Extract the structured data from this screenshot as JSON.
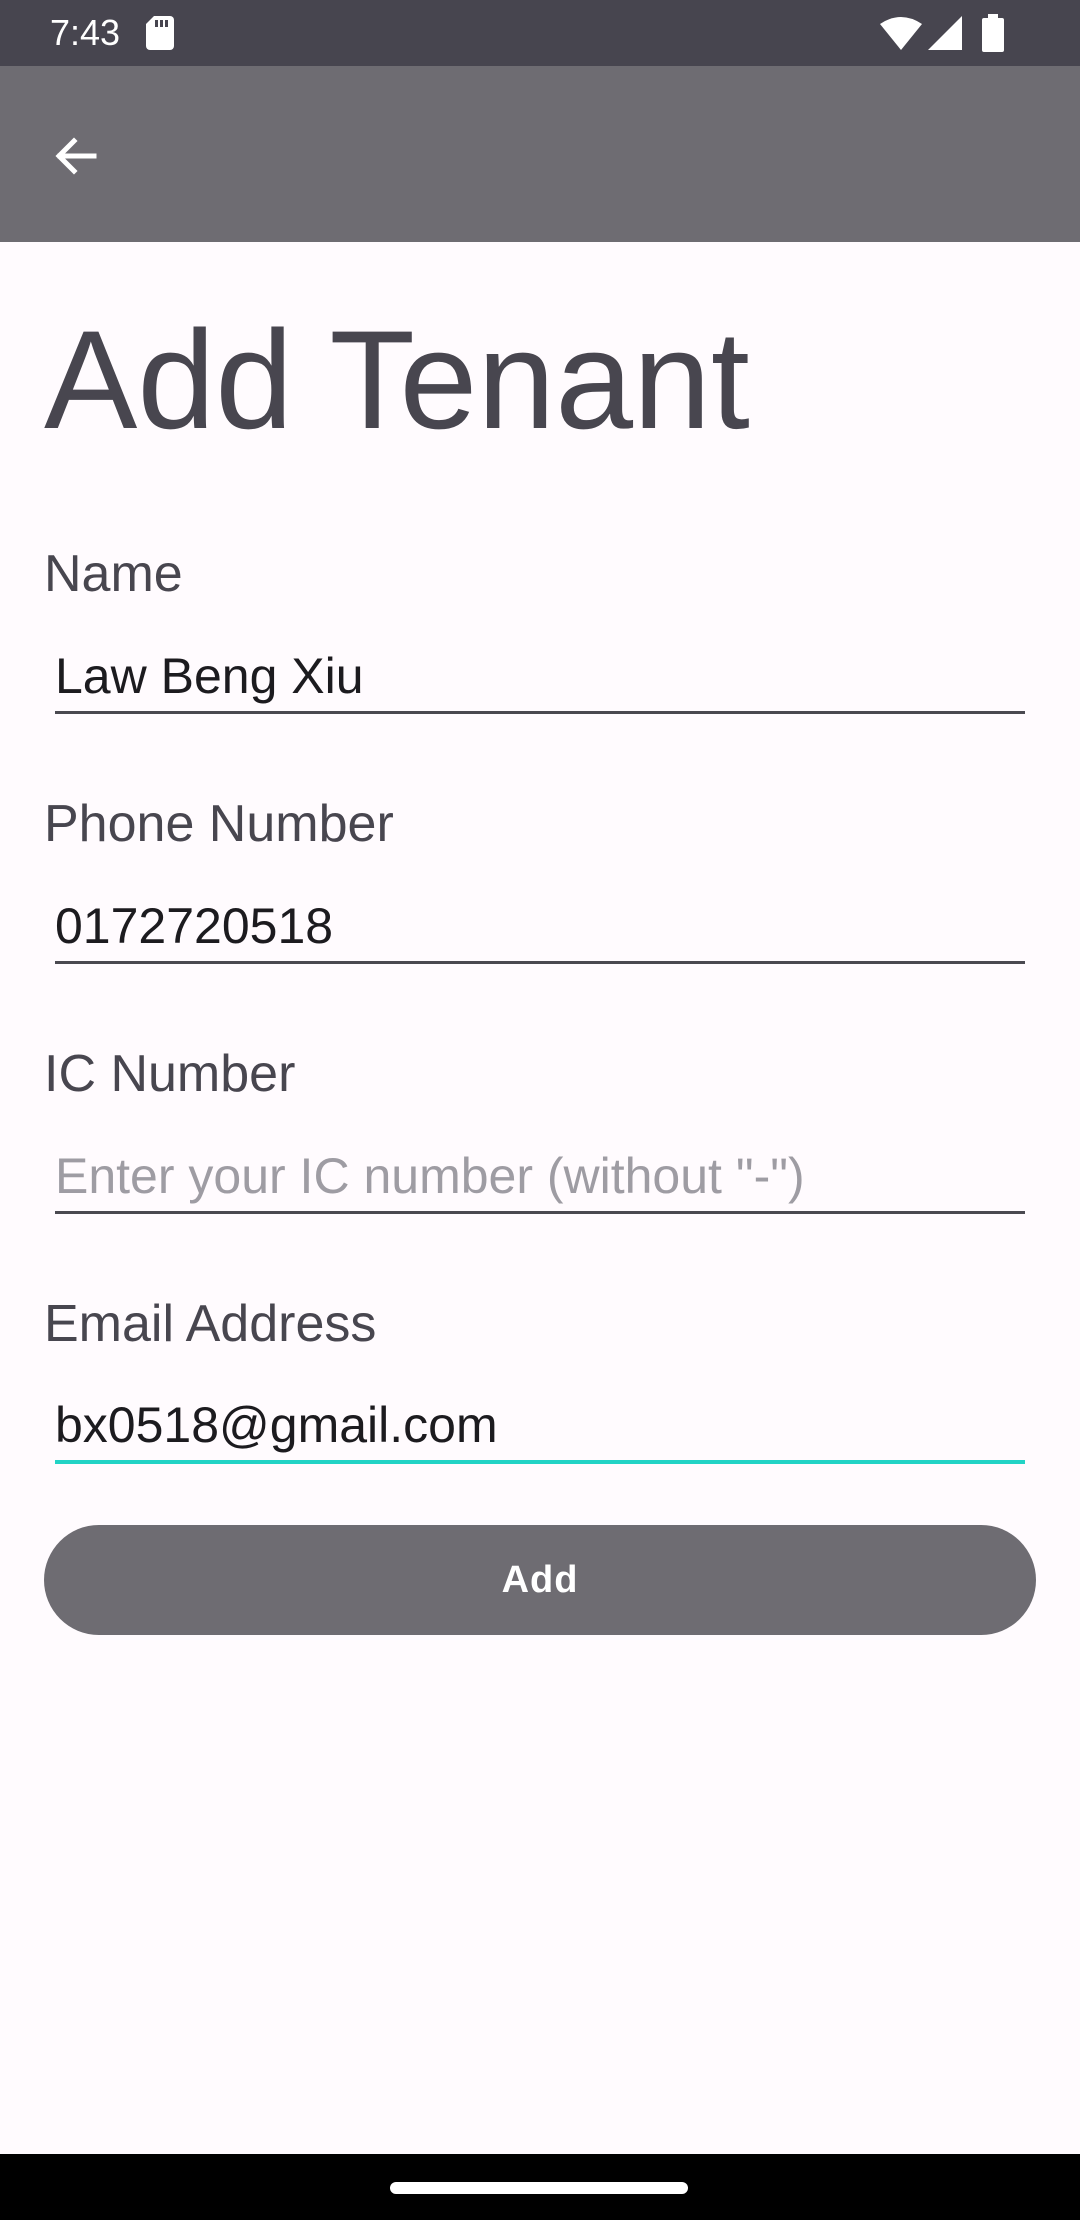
{
  "status_bar": {
    "time": "7:43",
    "icons": [
      "sd-card-icon",
      "wifi-icon",
      "signal-icon",
      "battery-icon"
    ]
  },
  "app_bar": {
    "back_icon": "arrow-back-icon",
    "background": "#6e6c72"
  },
  "page": {
    "title": "Add Tenant"
  },
  "form": {
    "name": {
      "label": "Name",
      "value": "Law Beng Xiu",
      "placeholder": ""
    },
    "phone": {
      "label": "Phone Number",
      "value": "0172720518",
      "placeholder": ""
    },
    "ic": {
      "label": "IC Number",
      "value": "",
      "placeholder": "Enter your IC number (without \"-\")"
    },
    "email": {
      "label": "Email Address",
      "value": "bx0518@gmail.com",
      "placeholder": ""
    },
    "submit_label": "Add"
  },
  "colors": {
    "accent": "#22d3c5",
    "status_bar": "#47454f",
    "background": "#fffbfe",
    "text": "#48464f"
  }
}
